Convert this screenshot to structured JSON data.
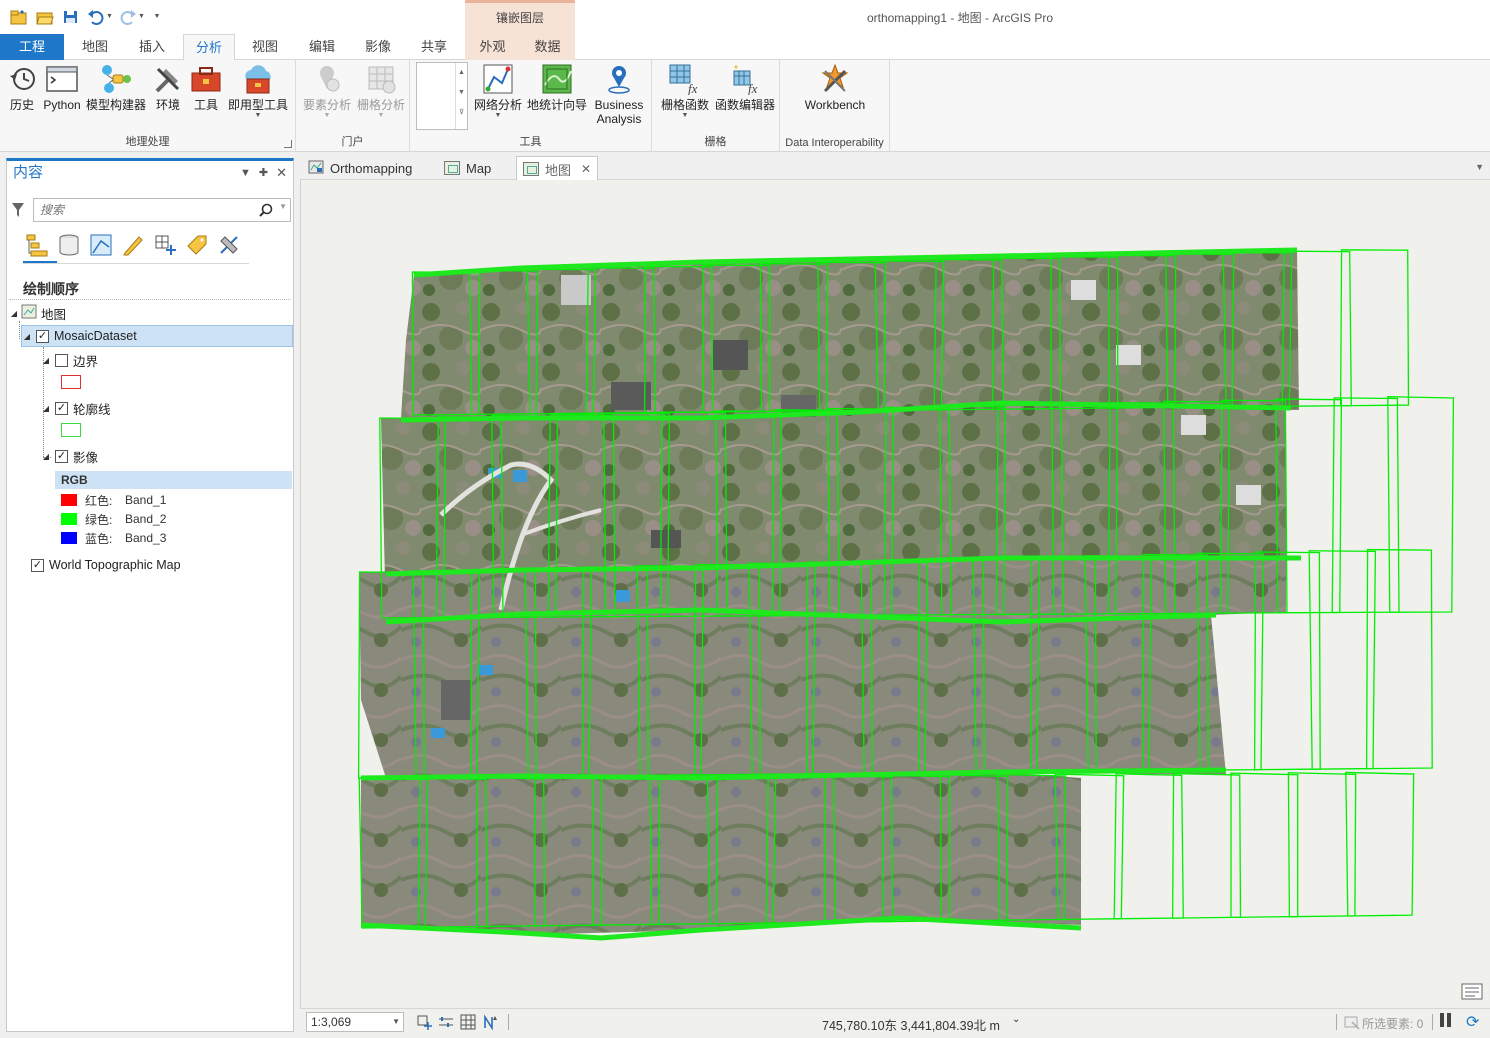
{
  "window": {
    "title": "orthomapping1 - 地图 - ArcGIS Pro",
    "contextual_tab_header": "镶嵌图层"
  },
  "quick_access": [
    "new-project-icon",
    "open-project-icon",
    "save-project-icon",
    "undo-icon",
    "redo-icon",
    "customize-icon"
  ],
  "tabs": [
    {
      "label": "工程"
    },
    {
      "label": "地图"
    },
    {
      "label": "插入"
    },
    {
      "label": "分析"
    },
    {
      "label": "视图"
    },
    {
      "label": "编辑"
    },
    {
      "label": "影像"
    },
    {
      "label": "共享"
    },
    {
      "label": "外观"
    },
    {
      "label": "数据"
    }
  ],
  "ribbon": {
    "geoprocessing": {
      "label": "地理处理",
      "buttons": [
        {
          "label": "历史"
        },
        {
          "label": "Python"
        },
        {
          "label": "模型构建器"
        },
        {
          "label": "环境"
        },
        {
          "label": "工具"
        },
        {
          "label": "即用型工具"
        }
      ]
    },
    "portal": {
      "label": "门户",
      "buttons": [
        {
          "label": "要素分析"
        },
        {
          "label": "栅格分析"
        }
      ]
    },
    "tools": {
      "label": "工具",
      "buttons": [
        {
          "label": "网络分析"
        },
        {
          "label": "地统计向导"
        },
        {
          "label": "Business Analysis"
        }
      ]
    },
    "raster": {
      "label": "栅格",
      "buttons": [
        {
          "label": "栅格函数"
        },
        {
          "label": "函数编辑器"
        }
      ]
    },
    "interop": {
      "label": "Data Interoperability",
      "buttons": [
        {
          "label": "Workbench"
        }
      ]
    }
  },
  "contents": {
    "title": "内容",
    "search_placeholder": "搜索",
    "draw_order_label": "绘制顺序",
    "layers": {
      "map": "地图",
      "mosaic": "MosaicDataset",
      "boundary": "边界",
      "footprint": "轮廓线",
      "image": "影像",
      "rgb": "RGB",
      "bands": [
        {
          "channel": "红色:",
          "band": "Band_1",
          "color": "#ff0000"
        },
        {
          "channel": "绿色:",
          "band": "Band_2",
          "color": "#00ff00"
        },
        {
          "channel": "蓝色:",
          "band": "Band_3",
          "color": "#0000ff"
        }
      ],
      "basemap": "World Topographic Map"
    },
    "checked": {
      "mosaic": true,
      "boundary": false,
      "footprint": true,
      "image": true,
      "basemap": true
    },
    "boundary_color": "#e03030",
    "footprint_color": "#3ddc3d"
  },
  "view_tabs": [
    {
      "label": "Orthomapping"
    },
    {
      "label": "Map"
    },
    {
      "label": "地图"
    }
  ],
  "statusbar": {
    "scale": "1:3,069",
    "coordinates": "745,780.10东 3,441,804.39北 m",
    "selected_features": "所选要素: 0"
  },
  "colors": {
    "accent": "#1f77c9",
    "footprint_green": "#00ee00"
  }
}
